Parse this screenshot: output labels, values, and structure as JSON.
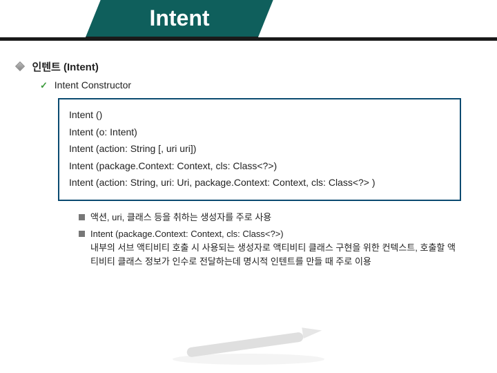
{
  "header": {
    "title": "Intent"
  },
  "section": {
    "title": "인텐트 (Intent)",
    "sub": "Intent Constructor"
  },
  "constructors": [
    "Intent ()",
    "Intent (o: Intent)",
    "Intent (action: String [, uri uri])",
    "Intent (package.Context: Context, cls: Class<?>)",
    "Intent (action: String, uri: Uri, package.Context: Context, cls: Class<?> )"
  ],
  "notes": [
    {
      "text": "액션, uri, 클래스 등을 취하는 생성자를 주로 사용"
    },
    {
      "text": "Intent (package.Context: Context, cls: Class<?>)\n내부의 서브 액티비티 호출 시 사용되는 생성자로 액티비티 클래스 구현을 위한 컨텍스트, 호출할 액티비티 클래스 정보가 인수로 전달하는데 명시적 인텐트를 만들 때 주로 이용"
    }
  ]
}
